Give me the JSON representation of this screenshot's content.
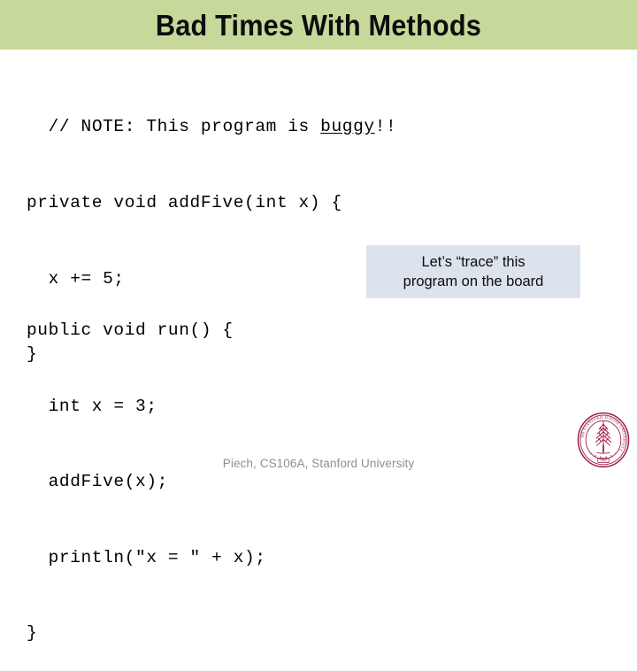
{
  "slide": {
    "title": "Bad Times With Methods",
    "banner_color": "#c6d99b",
    "background_color": "#ffffff"
  },
  "code": {
    "comment_block": {
      "prefix": "// NOTE: This program is ",
      "underlined_word": "buggy",
      "suffix": "!!"
    },
    "add_five_block": [
      "private void addFive(int x) {",
      "  x += 5;",
      "}"
    ],
    "run_block": [
      "public void run() {",
      "  int x = 3;",
      "  addFive(x);",
      "  println(\"x = \" + x);",
      "}"
    ]
  },
  "callout": {
    "background_color": "#dce3ed",
    "lines": [
      "Let’s “trace” this",
      "program on the board"
    ]
  },
  "footer": {
    "credit": "Piech, CS106A, Stanford University",
    "text_color": "#8f8f8f"
  },
  "logo": {
    "name": "stanford-university-seal",
    "ring_text": "LELAND STANFORD JUNIOR UNIVERSITY",
    "year": "1891",
    "color": "#9b1b48"
  }
}
